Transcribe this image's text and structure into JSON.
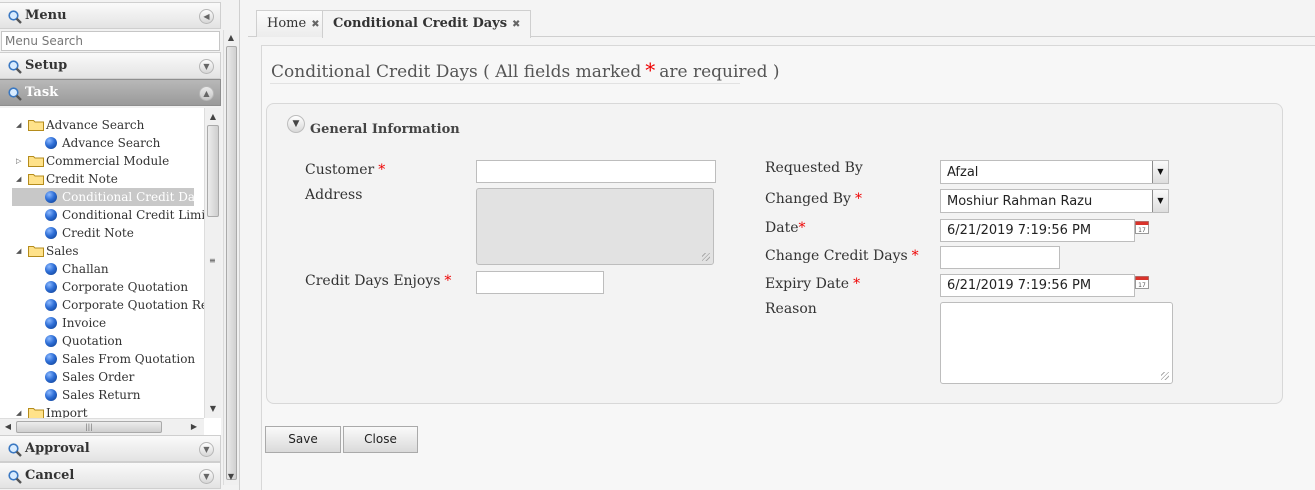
{
  "sidebar": {
    "menu_title": "Menu",
    "search_placeholder": "Menu Search",
    "sections": {
      "setup": "Setup",
      "task": "Task",
      "approval": "Approval",
      "cancel": "Cancel"
    },
    "tree": [
      {
        "label": "Advance Search"
      },
      {
        "label": "Advance Search"
      },
      {
        "label": "Commercial Module"
      },
      {
        "label": "Credit Note"
      },
      {
        "label": "Conditional Credit Days"
      },
      {
        "label": "Conditional Credit Limit"
      },
      {
        "label": "Credit Note"
      },
      {
        "label": "Sales"
      },
      {
        "label": "Challan"
      },
      {
        "label": "Corporate Quotation"
      },
      {
        "label": "Corporate Quotation Revis"
      },
      {
        "label": "Invoice"
      },
      {
        "label": "Quotation"
      },
      {
        "label": "Sales From Quotation"
      },
      {
        "label": "Sales Order"
      },
      {
        "label": "Sales Return"
      },
      {
        "label": "Import"
      }
    ]
  },
  "tabs": [
    {
      "label": "Home"
    },
    {
      "label": "Conditional Credit Days"
    }
  ],
  "page": {
    "title_main": "Conditional Credit Days ( All fields marked",
    "title_star": "*",
    "title_end": "are required )"
  },
  "form": {
    "section_label": "General Information",
    "required_marker": "*",
    "customer": {
      "label": "Customer",
      "value": ""
    },
    "address": {
      "label": "Address",
      "value": ""
    },
    "credit_days_enjoys": {
      "label": "Credit Days Enjoys",
      "value": ""
    },
    "requested_by": {
      "label": "Requested By",
      "value": "Afzal"
    },
    "changed_by": {
      "label": "Changed By",
      "value": "Moshiur Rahman Razu"
    },
    "date": {
      "label": "Date",
      "value": "6/21/2019 7:19:56 PM"
    },
    "change_credit_days": {
      "label": "Change Credit Days",
      "value": ""
    },
    "expiry_date": {
      "label": "Expiry Date",
      "value": "6/21/2019 7:19:56 PM"
    },
    "reason": {
      "label": "Reason",
      "value": ""
    }
  },
  "buttons": {
    "save": "Save",
    "close": "Close"
  },
  "icons": {
    "menu": "magnifier-icon",
    "collapse": "chevron-left-icon",
    "section": "chevron-down-icon",
    "folder": "folder-icon",
    "leaf": "blue-ball-icon",
    "calendar": "calendar-icon",
    "dropdown": "dropdown-arrow-icon"
  },
  "colors": {
    "required": "#ee0000",
    "active_header": "#a8a8a8",
    "selected_tree_item": "#c8c8c8"
  }
}
